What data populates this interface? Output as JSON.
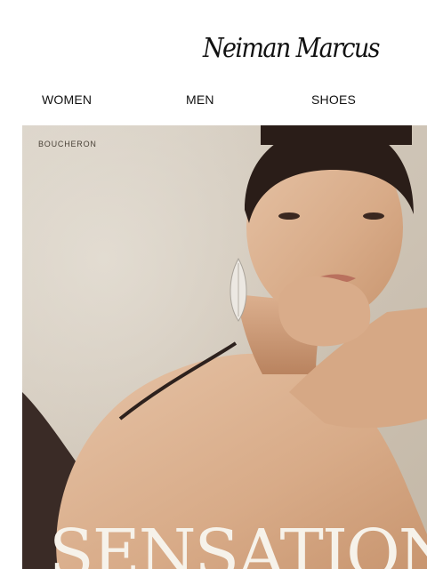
{
  "header": {
    "logo_text": "Neiman Marcus"
  },
  "nav": {
    "items": [
      {
        "label": "WOMEN"
      },
      {
        "label": "MEN"
      },
      {
        "label": "SHOES"
      }
    ]
  },
  "hero": {
    "brand": "BOUCHERON",
    "headline": "SENSATIONA"
  }
}
